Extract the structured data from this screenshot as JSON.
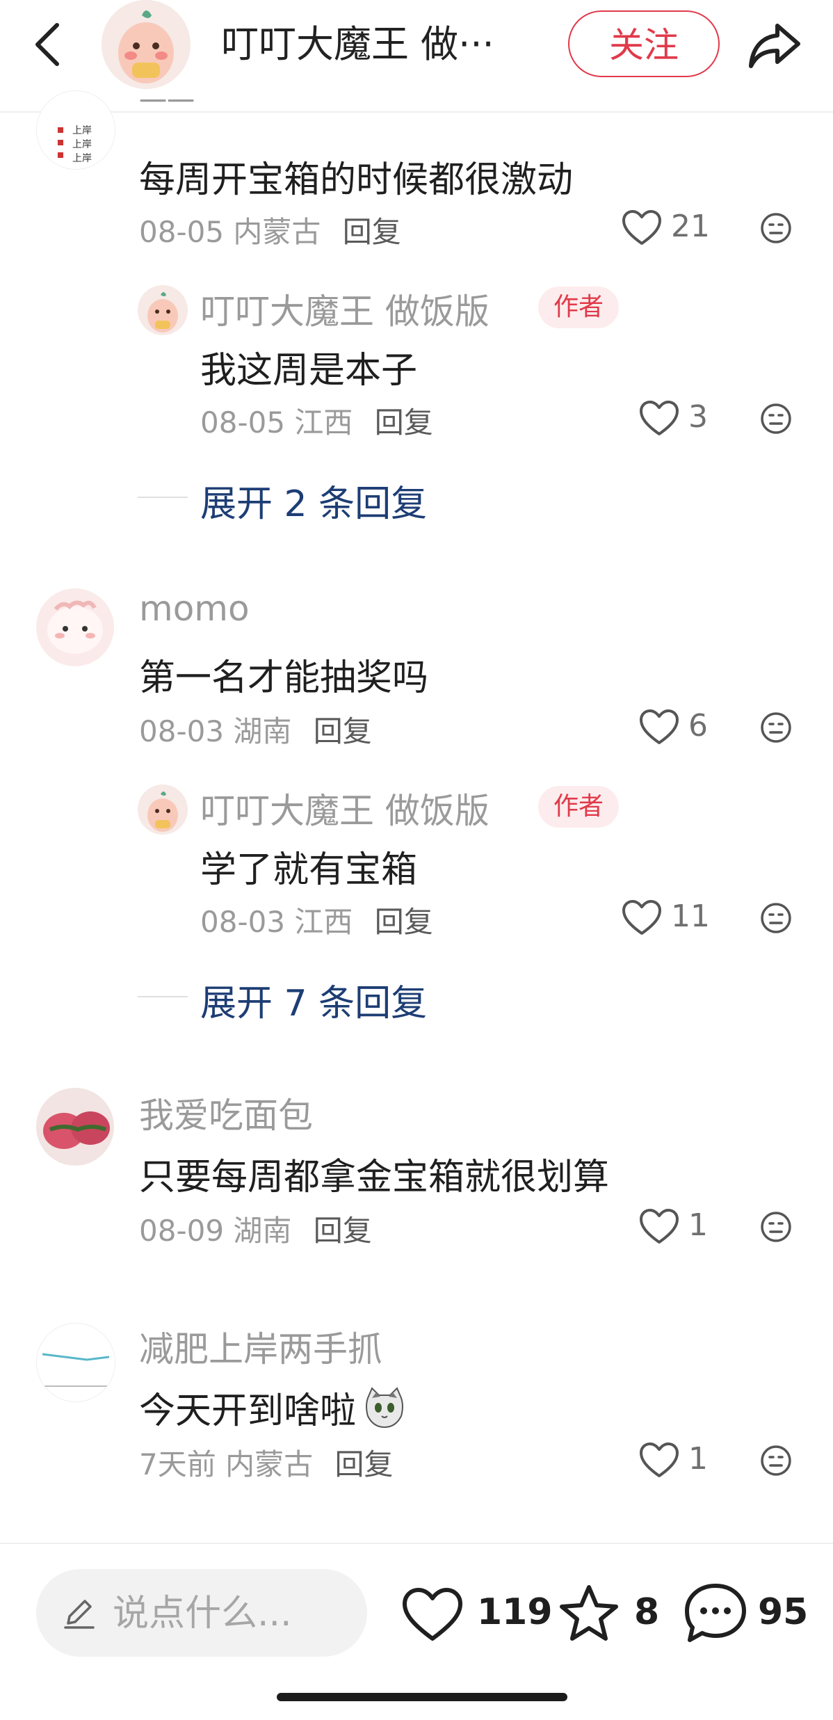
{
  "header": {
    "title": "叮叮大魔王 做···",
    "follow_label": "关注"
  },
  "comments": [
    {
      "name": "一一",
      "text": "每周开宝箱的时候都很激动",
      "date": "08-05",
      "location": "内蒙古",
      "reply_label": "回复",
      "likes": "21",
      "avatar_text": [
        "上岸",
        "上岸",
        "上岸"
      ],
      "sub_reply": {
        "name": "叮叮大魔王 做饭版",
        "badge": "作者",
        "text": "我这周是本子",
        "date": "08-05",
        "location": "江西",
        "reply_label": "回复",
        "likes": "3"
      },
      "expand_label": "展开 2 条回复"
    },
    {
      "name": "momo",
      "text": "第一名才能抽奖吗",
      "date": "08-03",
      "location": "湖南",
      "reply_label": "回复",
      "likes": "6",
      "sub_reply": {
        "name": "叮叮大魔王 做饭版",
        "badge": "作者",
        "text": "学了就有宝箱",
        "date": "08-03",
        "location": "江西",
        "reply_label": "回复",
        "likes": "11"
      },
      "expand_label": "展开 7 条回复"
    },
    {
      "name": "我爱吃面包",
      "text": "只要每周都拿金宝箱就很划算",
      "date": "08-09",
      "location": "湖南",
      "reply_label": "回复",
      "likes": "1"
    },
    {
      "name": "减肥上岸两手抓",
      "text": "今天开到啥啦",
      "date": "7天前",
      "location": "内蒙古",
      "reply_label": "回复",
      "likes": "1"
    }
  ],
  "bottom_bar": {
    "input_placeholder": "说点什么...",
    "like_count": "119",
    "star_count": "8",
    "comment_count": "95"
  },
  "colors": {
    "accent_red": "#e03a4a",
    "expand_blue": "#1d3d74",
    "meta_gray": "#9a9a9a"
  }
}
